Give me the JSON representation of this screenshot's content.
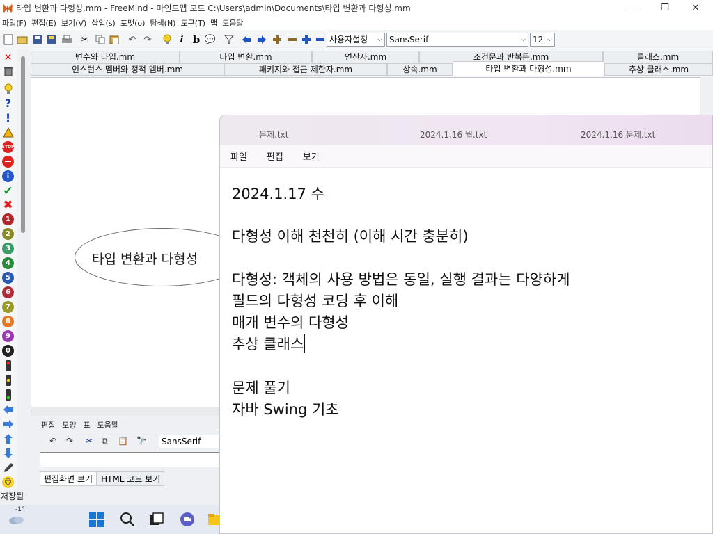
{
  "freemind": {
    "title": "타입 변환과 다형성.mm - FreeMind - 마인드맵 모드 C:\\Users\\admin\\Documents\\타입 변환과 다형성.mm",
    "menu": [
      "파일(F)",
      "편집(E)",
      "보기(V)",
      "삽입(s)",
      "포맷(o)",
      "탐색(N)",
      "도구(T)",
      "맵",
      "도움말"
    ],
    "toolbar": {
      "style_combo": "사용자설정",
      "font_combo": "SansSerif",
      "size_combo": "12"
    },
    "tabs_row1": [
      "변수와 타입.mm",
      "타입 변환.mm",
      "연산자.mm",
      "조건문과 반복문.mm",
      "클래스.mm"
    ],
    "tabs_row2": [
      "인스턴스 멤버와 정적 멤버.mm",
      "패키지와 접근 제한자.mm",
      "상속.mm",
      "타입 변환과 다형성.mm",
      "추상 클래스.mm"
    ],
    "root_node": "타입 변환과 다형성",
    "editor": {
      "menu": [
        "편집",
        "모양",
        "표",
        "도움말"
      ],
      "font": "SansSerif",
      "tab_edit": "편집화면 보기",
      "tab_html": "HTML 코드 보기"
    },
    "status": "저장됨",
    "icon_numbers": [
      "1",
      "2",
      "3",
      "4",
      "5",
      "6",
      "7",
      "8",
      "9",
      "0"
    ]
  },
  "notepad": {
    "tabs": [
      "문제.txt",
      "2024.1.16 월.txt",
      "2024.1.16 문제.txt"
    ],
    "menu": [
      "파일",
      "편집",
      "보기"
    ],
    "lines": [
      "2024.1.17 수",
      "다형성 이해 천천히 (이해 시간 충분히)",
      "다형성: 객체의 사용 방법은 동일, 실행 결과는 다양하게",
      "필드의 다형성 코딩 후 이해",
      "매개 변수의 다형성",
      "추상 클래스",
      "문제 풀기",
      "자바 Swing 기초"
    ]
  },
  "taskbar": {
    "weather_temp": "-1°"
  }
}
